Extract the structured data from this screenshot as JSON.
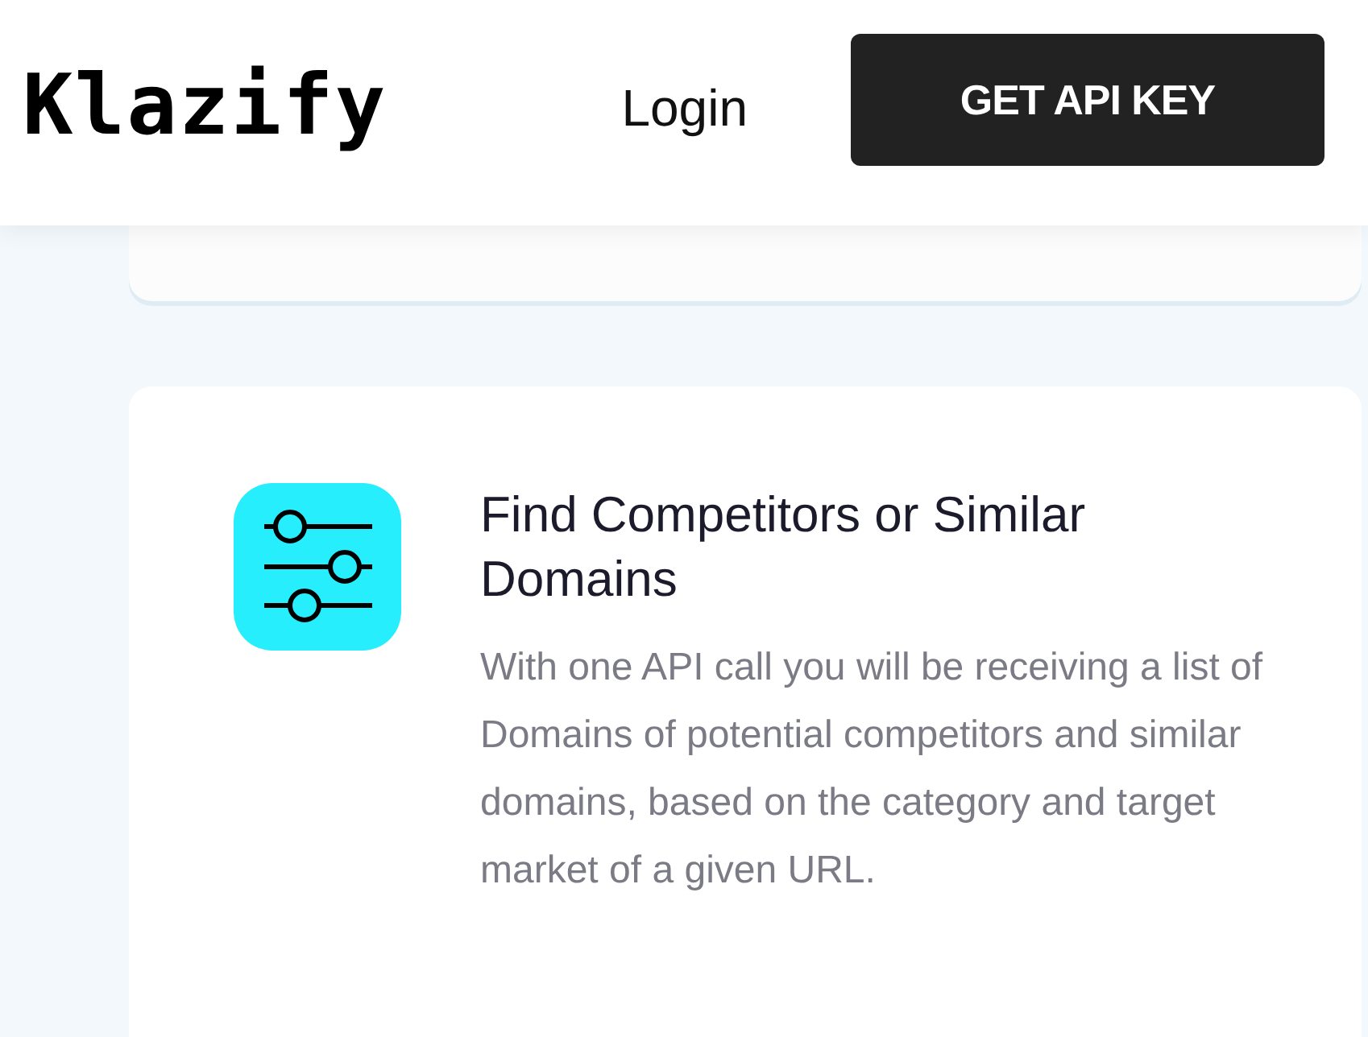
{
  "header": {
    "logo": "Klazify",
    "login": "Login",
    "cta": "GET API KEY"
  },
  "feature": {
    "title": "Find Competitors or Similar Domains",
    "description": "With one API call you will be receiving a list of Domains of potential competitors and similar domains, based on the category and target market of a given URL."
  }
}
